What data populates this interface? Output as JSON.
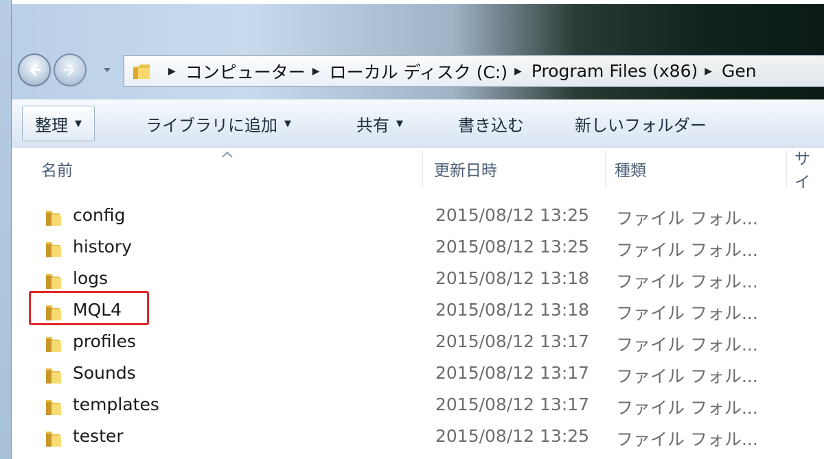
{
  "breadcrumbs": [
    "コンピューター",
    "ローカル ディスク (C:)",
    "Program Files (x86)",
    "Gen"
  ],
  "toolbar": {
    "organize": "整理",
    "add_to_library": "ライブラリに追加",
    "share": "共有",
    "burn": "書き込む",
    "new_folder": "新しいフォルダー"
  },
  "columns": {
    "name": "名前",
    "modified": "更新日時",
    "type": "種類",
    "size": "サイ"
  },
  "files": [
    {
      "name": "config",
      "modified": "2015/08/12 13:25",
      "type": "ファイル フォル..."
    },
    {
      "name": "history",
      "modified": "2015/08/12 13:25",
      "type": "ファイル フォル..."
    },
    {
      "name": "logs",
      "modified": "2015/08/12 13:18",
      "type": "ファイル フォル..."
    },
    {
      "name": "MQL4",
      "modified": "2015/08/12 13:18",
      "type": "ファイル フォル..."
    },
    {
      "name": "profiles",
      "modified": "2015/08/12 13:17",
      "type": "ファイル フォル..."
    },
    {
      "name": "Sounds",
      "modified": "2015/08/12 13:17",
      "type": "ファイル フォル..."
    },
    {
      "name": "templates",
      "modified": "2015/08/12 13:17",
      "type": "ファイル フォル..."
    },
    {
      "name": "tester",
      "modified": "2015/08/12 13:25",
      "type": "ファイル フォル..."
    }
  ],
  "highlight_color": "#e02a2a",
  "icons": {
    "folder": "folder-icon",
    "back": "back-arrow-icon",
    "forward": "forward-arrow-icon"
  }
}
